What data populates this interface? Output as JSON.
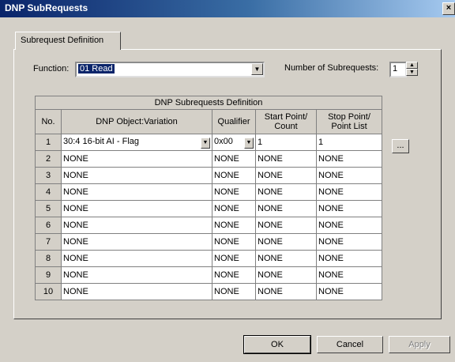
{
  "window": {
    "title": "DNP SubRequests",
    "close_label": "×"
  },
  "tab": {
    "label": "Subrequest Definition"
  },
  "function": {
    "label": "Function:",
    "value": "01 Read"
  },
  "subrequests": {
    "label": "Number of Subrequests:",
    "value": "1"
  },
  "table": {
    "caption": "DNP Subrequests Definition",
    "headers": [
      "No.",
      "DNP Object:Variation",
      "Qualifier",
      "Start Point/ Count",
      "Stop Point/ Point List"
    ],
    "rows": [
      {
        "no": "1",
        "obj": "30:4 16-bit AI - Flag",
        "qual": "0x00",
        "start": "1",
        "stop": "1"
      },
      {
        "no": "2",
        "obj": "NONE",
        "qual": "NONE",
        "start": "NONE",
        "stop": "NONE"
      },
      {
        "no": "3",
        "obj": "NONE",
        "qual": "NONE",
        "start": "NONE",
        "stop": "NONE"
      },
      {
        "no": "4",
        "obj": "NONE",
        "qual": "NONE",
        "start": "NONE",
        "stop": "NONE"
      },
      {
        "no": "5",
        "obj": "NONE",
        "qual": "NONE",
        "start": "NONE",
        "stop": "NONE"
      },
      {
        "no": "6",
        "obj": "NONE",
        "qual": "NONE",
        "start": "NONE",
        "stop": "NONE"
      },
      {
        "no": "7",
        "obj": "NONE",
        "qual": "NONE",
        "start": "NONE",
        "stop": "NONE"
      },
      {
        "no": "8",
        "obj": "NONE",
        "qual": "NONE",
        "start": "NONE",
        "stop": "NONE"
      },
      {
        "no": "9",
        "obj": "NONE",
        "qual": "NONE",
        "start": "NONE",
        "stop": "NONE"
      },
      {
        "no": "10",
        "obj": "NONE",
        "qual": "NONE",
        "start": "NONE",
        "stop": "NONE"
      }
    ]
  },
  "ellipsis_label": "...",
  "buttons": {
    "ok": "OK",
    "cancel": "Cancel",
    "apply": "Apply"
  }
}
